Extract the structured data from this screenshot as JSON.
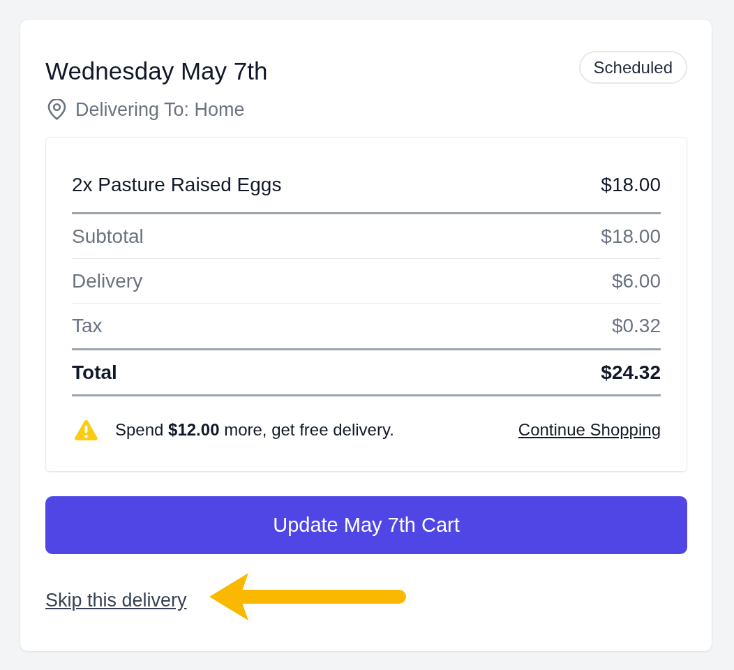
{
  "header": {
    "title": "Wednesday May 7th",
    "status": "Scheduled",
    "location": "Delivering To: Home"
  },
  "order": {
    "items": [
      {
        "label": "2x Pasture Raised Eggs",
        "price": "$18.00"
      }
    ],
    "summary": [
      {
        "label": "Subtotal",
        "amount": "$18.00"
      },
      {
        "label": "Delivery",
        "amount": "$6.00"
      },
      {
        "label": "Tax",
        "amount": "$0.32"
      }
    ],
    "total": {
      "label": "Total",
      "amount": "$24.32"
    },
    "notice": {
      "message": "Spend **$12.00** more, get free delivery.",
      "link": "Continue Shopping"
    }
  },
  "actions": {
    "primary": "Update May 7th Cart",
    "secondary": "Skip this delivery"
  }
}
